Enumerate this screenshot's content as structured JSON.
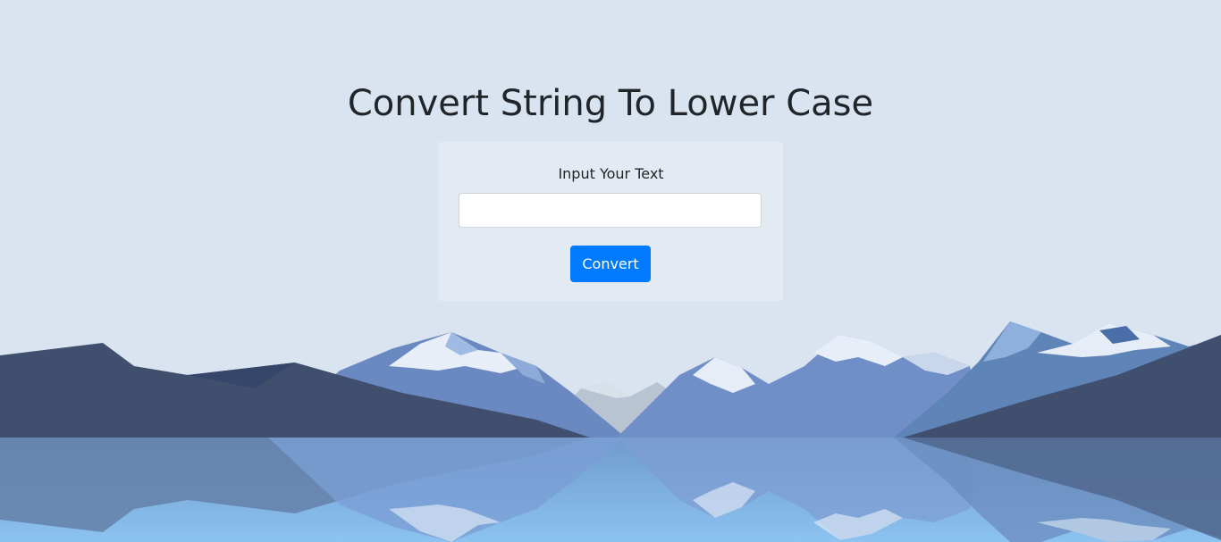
{
  "page": {
    "title": "Convert String To Lower Case"
  },
  "form": {
    "label": "Input Your Text",
    "input_value": "",
    "input_placeholder": "",
    "button_label": "Convert"
  },
  "colors": {
    "background": "#d9e4f0",
    "card_background": "#e3eaf2",
    "primary_button": "#007bff",
    "dark_mountain": "#3f4f6d",
    "blue_mountain": "#6a89c1",
    "water": "#88bde9"
  }
}
